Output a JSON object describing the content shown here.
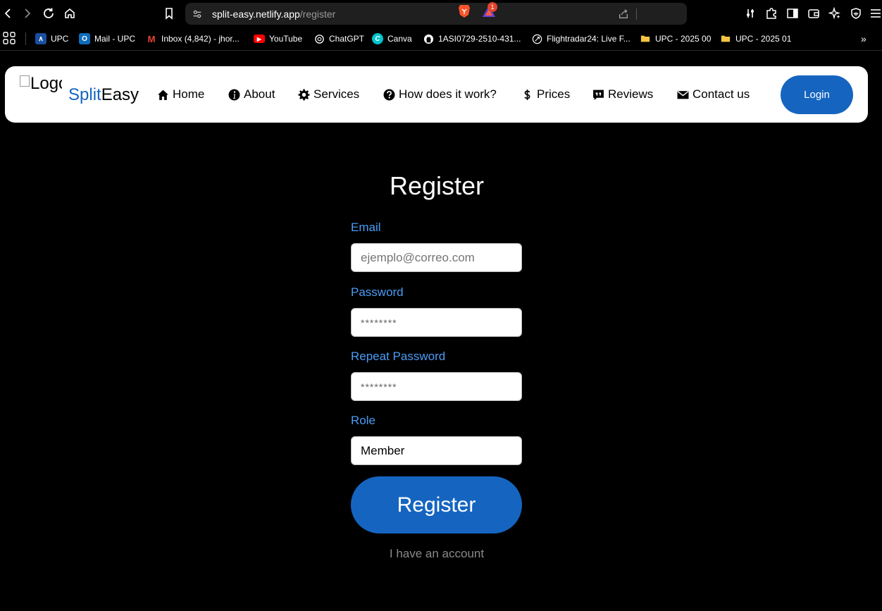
{
  "browser": {
    "url_domain": "split-easy.netlify.app",
    "url_path": "/register",
    "rewards_badge": "1",
    "bookmarks": [
      {
        "label": "UPC",
        "icon": "upc-icon",
        "color": "#1a4fa0"
      },
      {
        "label": "Mail - UPC",
        "icon": "outlook-icon",
        "color": "#0f6cbd"
      },
      {
        "label": "Inbox (4,842) - jhor...",
        "icon": "gmail-icon",
        "color": "#ea4335"
      },
      {
        "label": "YouTube",
        "icon": "youtube-icon",
        "color": "#ff0000"
      },
      {
        "label": "ChatGPT",
        "icon": "chatgpt-icon",
        "color": "#ffffff"
      },
      {
        "label": "Canva",
        "icon": "canva-icon",
        "color": "#00c4cc"
      },
      {
        "label": "1ASI0729-2510-431...",
        "icon": "github-icon",
        "color": "#ffffff"
      },
      {
        "label": "Flightradar24: Live F...",
        "icon": "flightradar-icon",
        "color": "#ffffff"
      },
      {
        "label": "UPC - 2025 00",
        "icon": "folder-icon",
        "color": "#f4c542"
      },
      {
        "label": "UPC - 2025 01",
        "icon": "folder-icon",
        "color": "#f4c542"
      }
    ],
    "more_label": "»"
  },
  "header": {
    "logo_alt": "Logo",
    "brand_split": "Split",
    "brand_easy": "Easy",
    "nav": [
      {
        "label": "Home",
        "icon": "home-icon"
      },
      {
        "label": "About",
        "icon": "info-icon"
      },
      {
        "label": "Services",
        "icon": "gear-icon"
      },
      {
        "label": "How does it work?",
        "icon": "question-icon"
      },
      {
        "label": "Prices",
        "icon": "dollar-icon"
      },
      {
        "label": "Reviews",
        "icon": "quote-icon"
      },
      {
        "label": "Contact us",
        "icon": "envelope-icon"
      }
    ],
    "login_label": "Login",
    "accent_color": "#1565c0"
  },
  "form": {
    "title": "Register",
    "email_label": "Email",
    "email_placeholder": "ejemplo@correo.com",
    "password_label": "Password",
    "password_placeholder": "********",
    "repeat_label": "Repeat Password",
    "repeat_placeholder": "********",
    "role_label": "Role",
    "role_value": "Member",
    "submit_label": "Register",
    "account_link": "I have an account",
    "label_color": "#4a9cf5"
  }
}
